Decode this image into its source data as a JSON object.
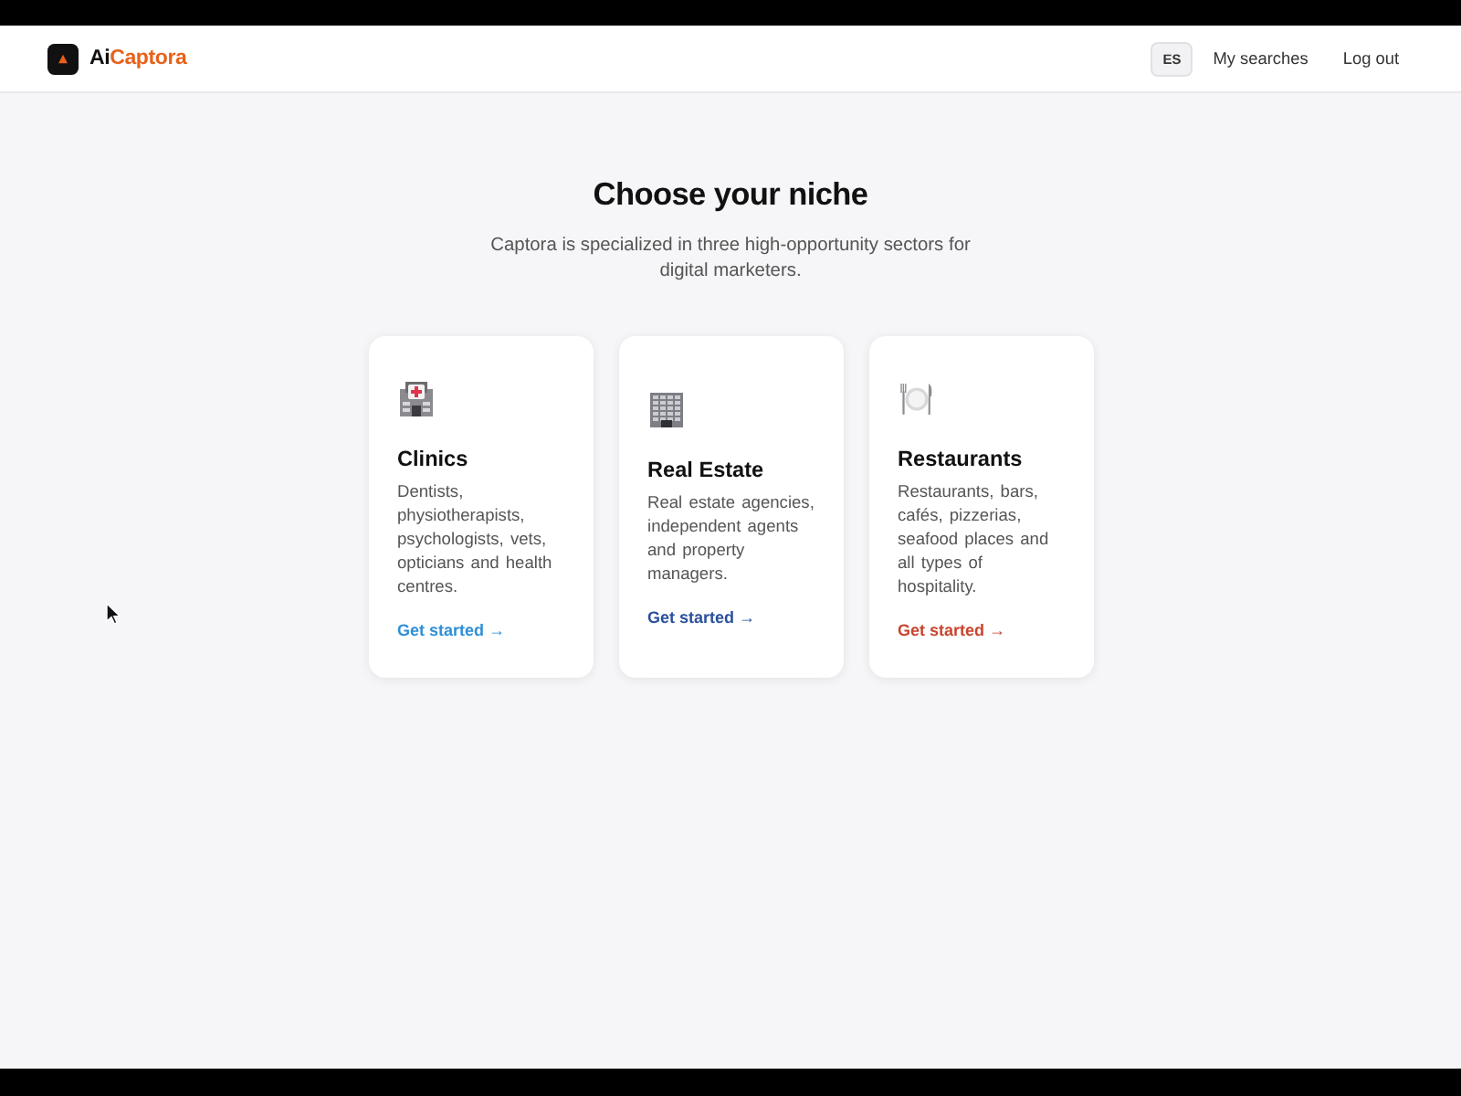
{
  "header": {
    "brand": {
      "prefix": "Ai",
      "accent": "Captora"
    },
    "language": "ES",
    "nav": [
      "My searches",
      "Log out"
    ]
  },
  "intro": {
    "title": "Choose your niche",
    "subtitle": "Captora is specialized in three high-opportunity sectors for digital marketers."
  },
  "niches": [
    {
      "kind": "clinic",
      "title": "Clinics",
      "description": "Dentists, physiotherapists, psychologists, vets, opticians and health centres.",
      "link": "Get started →",
      "color": "#2f8fd6"
    },
    {
      "kind": "building",
      "title": "Real Estate",
      "description": "Real estate agencies, independent agents and property managers.",
      "link": "Get started →",
      "color": "#2a4f9c"
    },
    {
      "kind": "restaurant",
      "title": "Restaurants",
      "description": "Restaurants, bars, cafés, pizzerias, seafood places and all types of hospitality.",
      "link": "Get started →",
      "color": "#c9442c"
    }
  ]
}
